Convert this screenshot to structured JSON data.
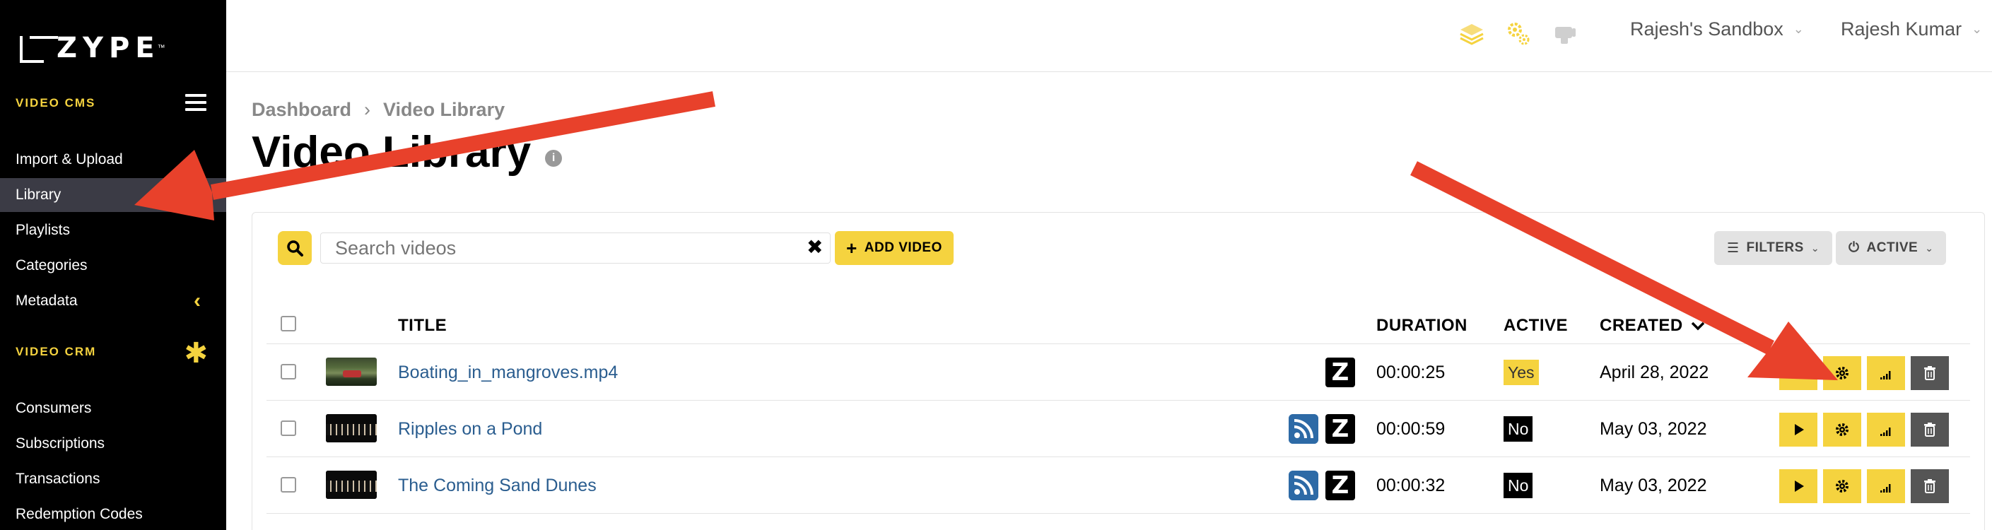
{
  "brand": {
    "logo_text": "ZYPE",
    "logo_tm": "™"
  },
  "sidebar": {
    "section_cms": "VIDEO CMS",
    "cms_items": [
      {
        "label": "Import & Upload"
      },
      {
        "label": "Library",
        "active": true
      },
      {
        "label": "Playlists"
      },
      {
        "label": "Categories"
      },
      {
        "label": "Metadata"
      }
    ],
    "section_crm": "VIDEO CRM",
    "crm_items": [
      {
        "label": "Consumers"
      },
      {
        "label": "Subscriptions"
      },
      {
        "label": "Transactions"
      },
      {
        "label": "Redemption Codes"
      }
    ]
  },
  "topbar": {
    "icons": [
      "layers-icon",
      "gears-icon",
      "hand-icon"
    ],
    "sandbox": "Rajesh's Sandbox",
    "user": "Rajesh Kumar"
  },
  "breadcrumb": {
    "items": [
      "Dashboard",
      "Video Library"
    ],
    "separator": "›"
  },
  "page": {
    "title": "Video Library",
    "info": "i"
  },
  "toolbar": {
    "search_placeholder": "Search videos",
    "clear": "✖",
    "add_video": "ADD VIDEO",
    "filters": "FILTERS",
    "active": "ACTIVE"
  },
  "table": {
    "headers": {
      "title": "TITLE",
      "duration": "DURATION",
      "active": "ACTIVE",
      "created": "CREATED"
    },
    "rows": [
      {
        "title": "Boating_in_mangroves.mp4",
        "duration": "00:00:25",
        "active": "Yes",
        "created": "April 28, 2022",
        "has_rss": false
      },
      {
        "title": "Ripples on a Pond",
        "duration": "00:00:59",
        "active": "No",
        "created": "May 03, 2022",
        "has_rss": true
      },
      {
        "title": "The Coming Sand Dunes",
        "duration": "00:00:32",
        "active": "No",
        "created": "May 03, 2022",
        "has_rss": true
      }
    ]
  },
  "colors": {
    "accent": "#f5d33f",
    "link": "#2a5d8f",
    "arrow": "#e8412b",
    "sidebar_bg": "#000000"
  }
}
